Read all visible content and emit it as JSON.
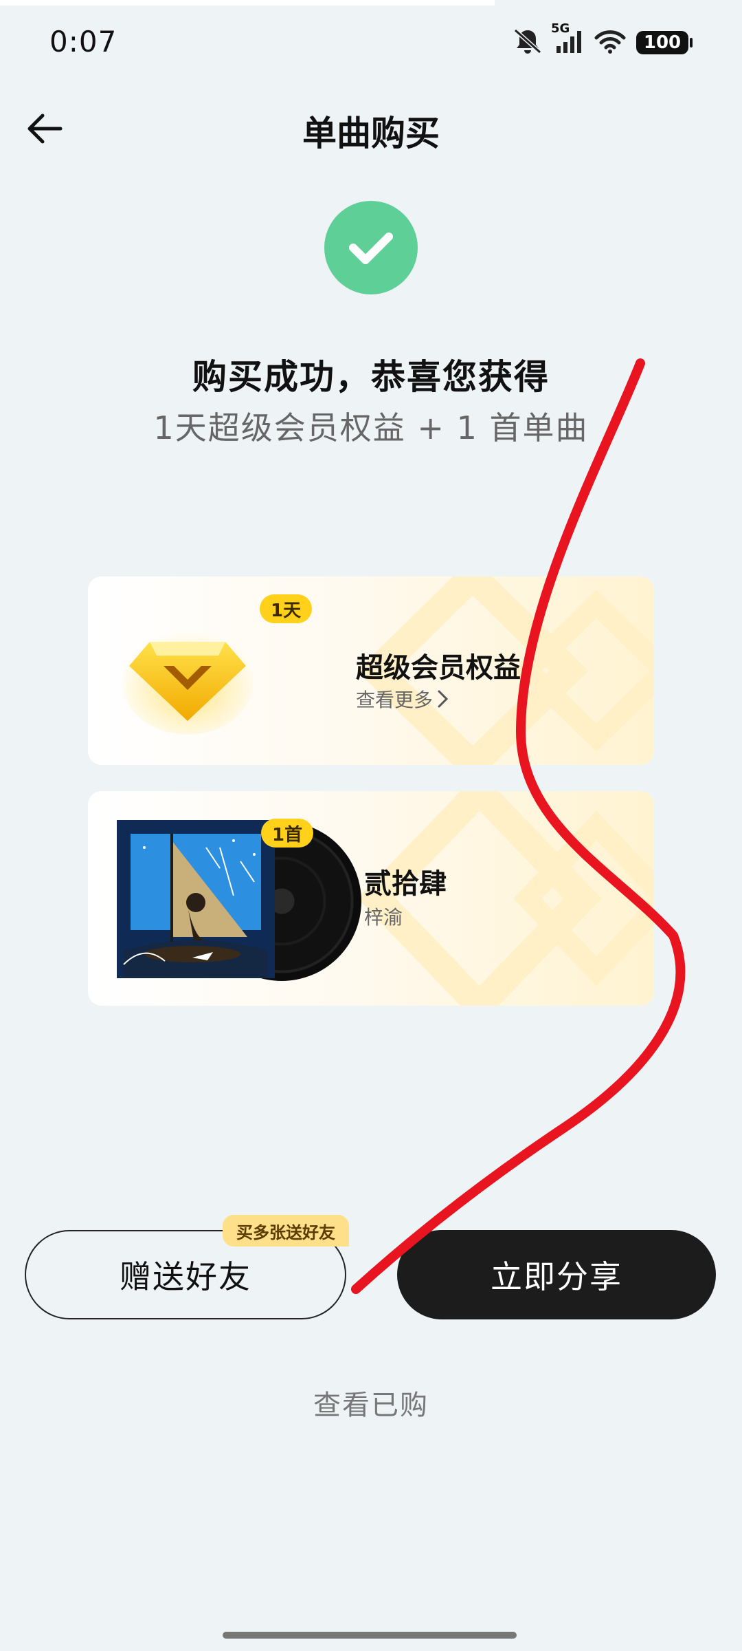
{
  "status_bar": {
    "time": "0:07",
    "network": "5G",
    "battery": "100",
    "icons": [
      "mute-bell-icon",
      "signal-icon",
      "wifi-icon",
      "battery-icon"
    ]
  },
  "nav": {
    "title": "单曲购买",
    "back_icon": "arrow-left-icon"
  },
  "success": {
    "icon": "check-circle-icon",
    "title": "购买成功，恭喜您获得",
    "subtitle": "1天超级会员权益 + 1 首单曲",
    "accent_color": "#5fcf98"
  },
  "cards": {
    "vip": {
      "badge": "1天",
      "title": "超级会员权益",
      "link": "查看更多",
      "icon": "diamond-icon"
    },
    "song": {
      "badge": "1首",
      "title": "贰拾肆",
      "artist": "梓渝",
      "icon": "album-cover"
    }
  },
  "actions": {
    "gift_label": "赠送好友",
    "gift_tag": "买多张送好友",
    "share_label": "立即分享",
    "view_purchased": "查看已购"
  },
  "colors": {
    "background": "#eef3f6",
    "badge": "#ffd11a",
    "primary_button": "#1c1c1c",
    "annotation_stroke": "#e8141f"
  }
}
